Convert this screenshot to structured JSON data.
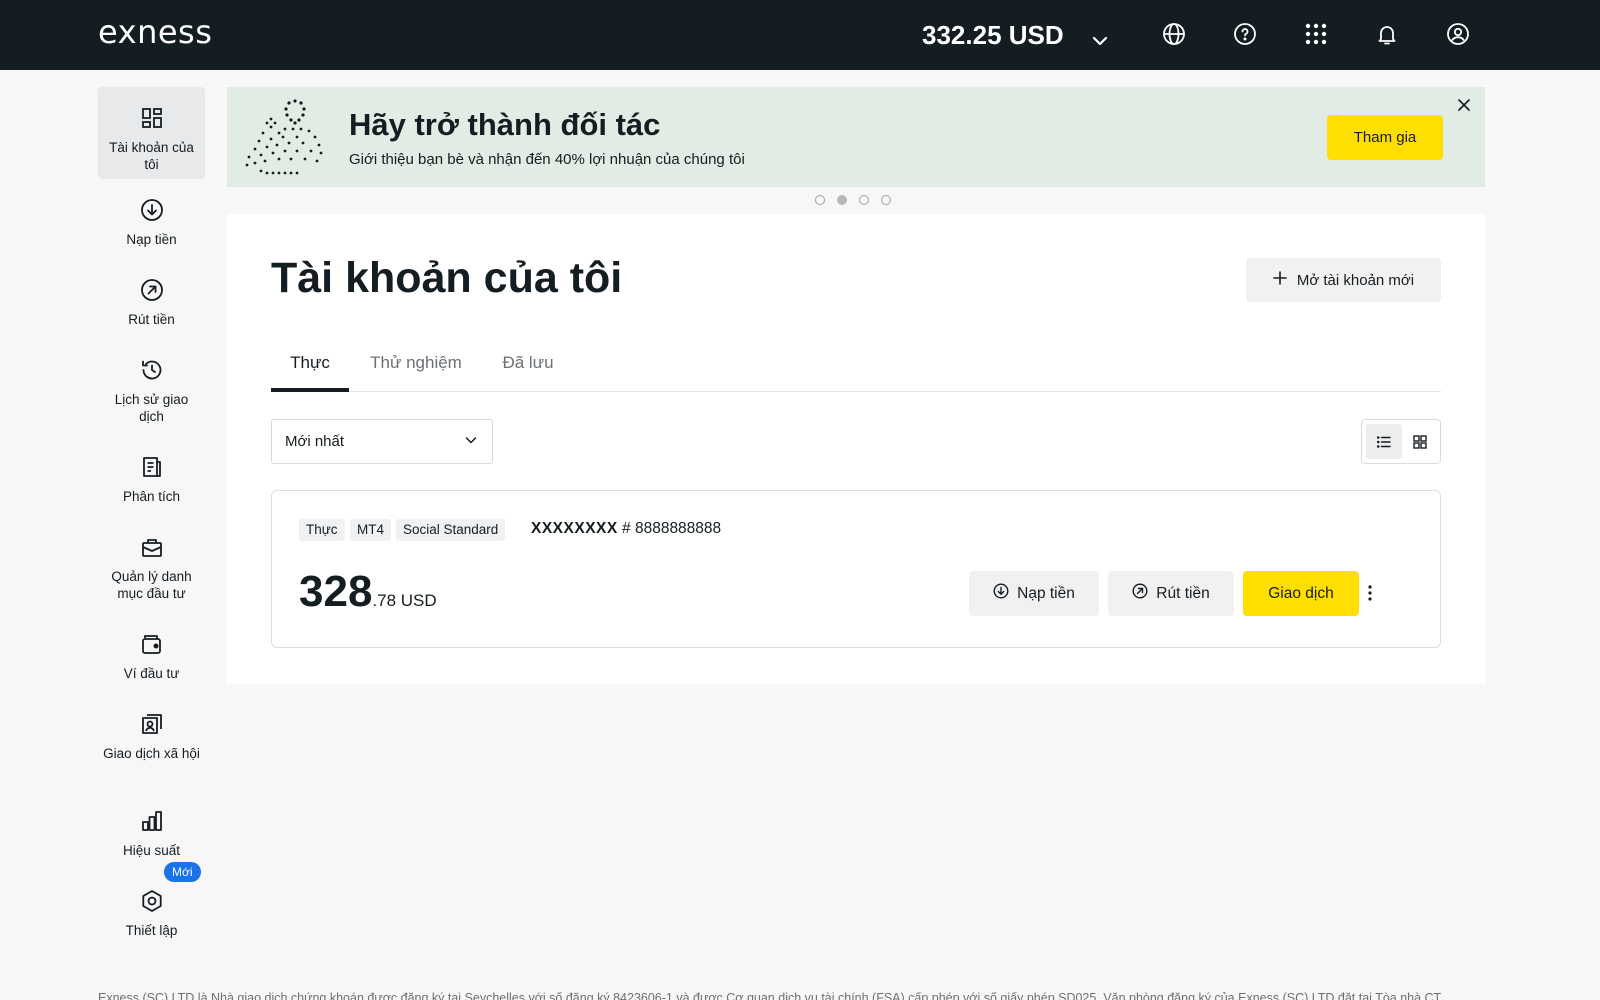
{
  "header": {
    "logo": "exness",
    "balance": "332.25 USD",
    "icons": [
      "chevron-down-icon",
      "globe-icon",
      "help-icon",
      "apps-grid-icon",
      "bell-icon",
      "user-icon"
    ]
  },
  "sidebar": {
    "items": [
      {
        "label": "Tài khoản của tôi",
        "icon": "dashboard-icon",
        "active": true
      },
      {
        "label": "Nạp tiền",
        "icon": "deposit-icon"
      },
      {
        "label": "Rút tiền",
        "icon": "withdraw-icon"
      },
      {
        "label": "Lịch sử giao dịch",
        "icon": "history-icon"
      },
      {
        "label": "Phân tích",
        "icon": "analytics-icon"
      },
      {
        "label": "Quản lý danh mục đầu tư",
        "icon": "portfolio-icon"
      },
      {
        "label": "Ví đầu tư",
        "icon": "wallet-icon"
      },
      {
        "label": "Giao dịch xã hội",
        "icon": "social-trading-icon"
      },
      {
        "label": "Hiệu suất",
        "icon": "performance-icon"
      },
      {
        "label": "Thiết lập",
        "icon": "settings-icon",
        "badge": "Mới"
      }
    ]
  },
  "banner": {
    "title": "Hãy trở thành đối tác",
    "subtitle": "Giới thiệu bạn bè và nhận đến 40% lợi nhuận của chúng tôi",
    "cta": "Tham gia",
    "pagination": {
      "count": 4,
      "active_index": 1
    }
  },
  "main": {
    "title": "Tài khoản của tôi",
    "open_account_label": "Mở tài khoản mới",
    "tabs": [
      {
        "label": "Thực",
        "active": true
      },
      {
        "label": "Thử nghiệm"
      },
      {
        "label": "Đã lưu"
      }
    ],
    "sort": {
      "selected": "Mới nhất"
    },
    "view_mode": "list"
  },
  "account": {
    "tags": [
      "Thực",
      "MT4",
      "Social Standard"
    ],
    "masked_name": "XXXXXXXX",
    "number": "# 8888888888",
    "amount_int": "328",
    "amount_dec": ".78 USD",
    "actions": {
      "deposit": "Nạp tiền",
      "withdraw": "Rút tiền",
      "trade": "Giao dịch"
    }
  },
  "colors": {
    "topbar": "#141d22",
    "accent_yellow": "#ffde02",
    "banner_bg": "#e1ece4",
    "badge_blue": "#1a73e8"
  },
  "footer": {
    "text": "Exness (SC) LTD là Nhà giao dịch chứng khoán được đăng ký tại Seychelles với số đăng ký 8423606-1 và được Cơ quan dịch vụ tài chính (FSA) cấp phép với số giấy phép SD025. Văn phòng đăng ký của Exness (SC) LTD đặt tại Tòa nhà CT"
  }
}
